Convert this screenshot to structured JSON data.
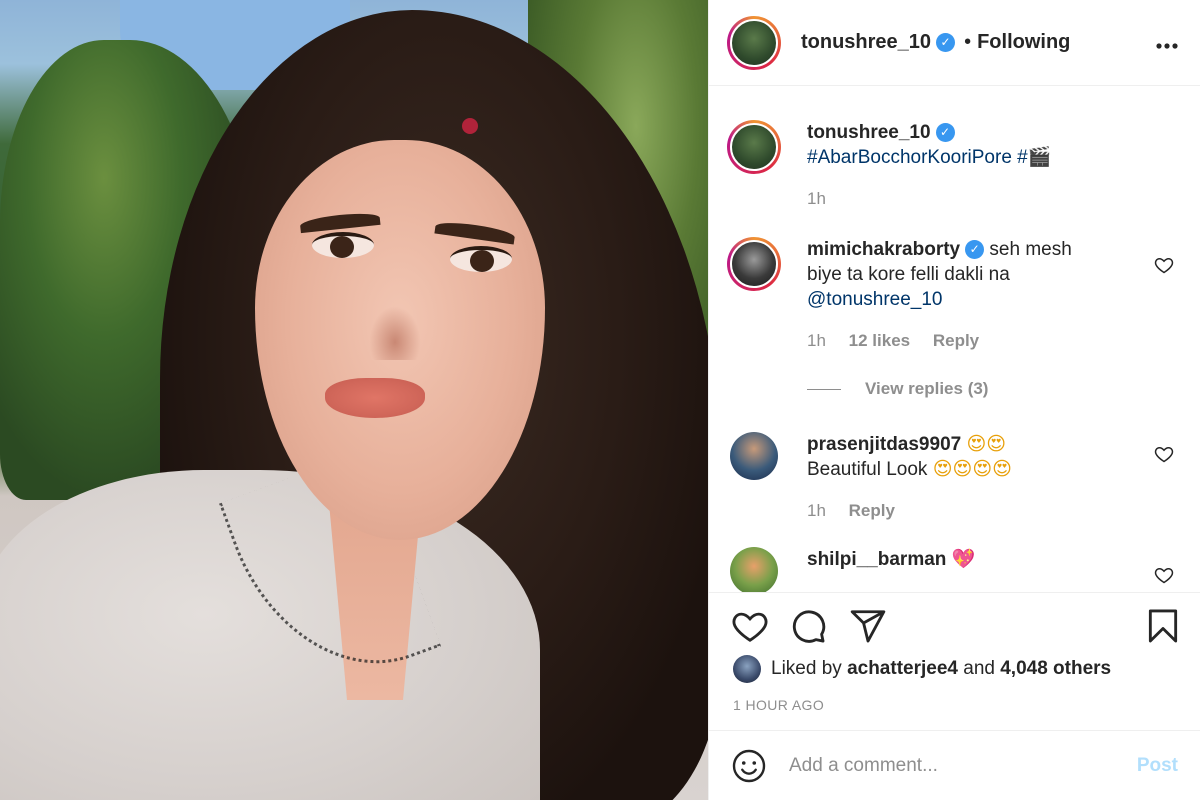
{
  "post": {
    "image_alt": "Selfie photo"
  },
  "header": {
    "username": "tonushree_10",
    "separator": "•",
    "follow_status": "Following",
    "more_icon": "more-horizontal-icon"
  },
  "caption": {
    "username": "tonushree_10",
    "text": "#AbarBocchorKooriPore #🎬",
    "time": "1h"
  },
  "comments": [
    {
      "username": "mimichakraborty",
      "text_line1": "seh mesh",
      "text_line2": "biye ta kore felli dakli na",
      "mention": "@tonushree_10",
      "time": "1h",
      "likes": "12 likes",
      "reply": "Reply",
      "view_replies": "View replies (3)"
    },
    {
      "username": "prasenjitdas9907",
      "emoji_after_name": "😍😍",
      "text": "Beautiful Look",
      "emoji_after_text": "😍😍😍😍",
      "time": "1h",
      "reply": "Reply"
    },
    {
      "username": "shilpi__barman",
      "emoji_after_name": "💖"
    }
  ],
  "actions": {
    "like_icon": "heart-icon",
    "comment_icon": "comment-icon",
    "share_icon": "share-icon",
    "save_icon": "bookmark-icon"
  },
  "likes": {
    "prefix": "Liked by",
    "user": "achatterjee4",
    "middle": "and",
    "others": "4,048 others"
  },
  "timestamp": "1 HOUR AGO",
  "add_comment": {
    "placeholder": "Add a comment...",
    "post_label": "Post"
  },
  "colors": {
    "verified": "#3897f0",
    "mention": "#003569",
    "muted": "#8e8e8e",
    "post_button_disabled": "#b2dffc"
  }
}
